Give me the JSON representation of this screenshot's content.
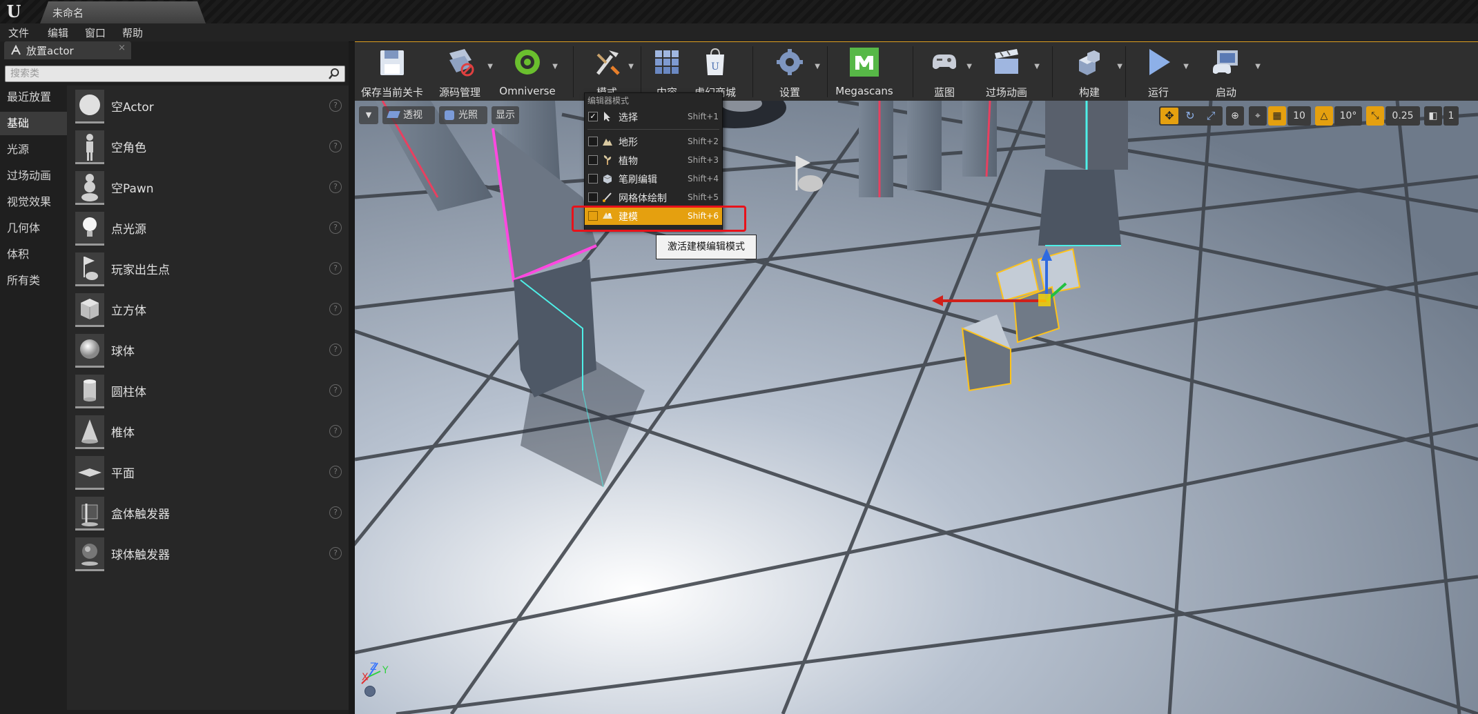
{
  "title_bar": {
    "document_tab": "未命名"
  },
  "menu_bar": {
    "items": [
      "文件",
      "编辑",
      "窗口",
      "帮助"
    ]
  },
  "place_panel": {
    "tab_label": "放置actor",
    "search_placeholder": "搜索类",
    "categories": [
      {
        "label": "最近放置",
        "active": false
      },
      {
        "label": "基础",
        "active": true
      },
      {
        "label": "光源",
        "active": false
      },
      {
        "label": "过场动画",
        "active": false
      },
      {
        "label": "视觉效果",
        "active": false
      },
      {
        "label": "几何体",
        "active": false
      },
      {
        "label": "体积",
        "active": false
      },
      {
        "label": "所有类",
        "active": false
      }
    ],
    "items": [
      {
        "label": "空Actor",
        "icon": "sphere-white-icon"
      },
      {
        "label": "空角色",
        "icon": "mannequin-icon"
      },
      {
        "label": "空Pawn",
        "icon": "pawn-icon"
      },
      {
        "label": "点光源",
        "icon": "lightbulb-icon"
      },
      {
        "label": "玩家出生点",
        "icon": "player-start-icon"
      },
      {
        "label": "立方体",
        "icon": "cube-icon"
      },
      {
        "label": "球体",
        "icon": "sphere-icon"
      },
      {
        "label": "圆柱体",
        "icon": "cylinder-icon"
      },
      {
        "label": "椎体",
        "icon": "cone-icon"
      },
      {
        "label": "平面",
        "icon": "plane-icon"
      },
      {
        "label": "盒体触发器",
        "icon": "box-trigger-icon"
      },
      {
        "label": "球体触发器",
        "icon": "sphere-trigger-icon"
      }
    ],
    "help_glyph": "?"
  },
  "toolbar": {
    "buttons": [
      {
        "label": "保存当前关卡",
        "icon": "save-icon",
        "dropdown": false
      },
      {
        "label": "源码管理",
        "icon": "source-control-icon",
        "dropdown": true
      },
      {
        "label": "Omniverse",
        "icon": "omniverse-icon",
        "dropdown": true
      },
      {
        "label": "模式",
        "icon": "modes-icon",
        "dropdown": true
      },
      {
        "label": "内容",
        "icon": "content-icon",
        "dropdown": false
      },
      {
        "label": "虚幻商城",
        "icon": "marketplace-icon",
        "dropdown": false
      },
      {
        "label": "设置",
        "icon": "settings-icon",
        "dropdown": true
      },
      {
        "label": "Megascans",
        "icon": "megascans-icon",
        "dropdown": false
      },
      {
        "label": "蓝图",
        "icon": "blueprint-icon",
        "dropdown": true
      },
      {
        "label": "过场动画",
        "icon": "cinematics-icon",
        "dropdown": true
      },
      {
        "label": "构建",
        "icon": "build-icon",
        "dropdown": true
      },
      {
        "label": "运行",
        "icon": "play-icon",
        "dropdown": true
      },
      {
        "label": "启动",
        "icon": "launch-icon",
        "dropdown": true
      }
    ]
  },
  "viewport": {
    "buttons": [
      {
        "label": "",
        "icon": "viewport-menu-icon"
      },
      {
        "label": "透视",
        "icon": "perspective-icon"
      },
      {
        "label": "光照",
        "icon": "lit-icon"
      },
      {
        "label": "显示",
        "icon": ""
      }
    ],
    "snap": {
      "grid_value": "10",
      "rotation_value": "10°",
      "scale_value": "0.25",
      "camera_speed": "1"
    },
    "axis_labels": {
      "x": "X",
      "y": "Y",
      "z": "Z"
    }
  },
  "modes_menu": {
    "header": "编辑器模式",
    "items": [
      {
        "label": "选择",
        "shortcut": "Shift+1",
        "checked": true,
        "highlighted": false,
        "icon": "select-arrow-icon"
      },
      {
        "label": "地形",
        "shortcut": "Shift+2",
        "checked": false,
        "highlighted": false,
        "icon": "landscape-icon"
      },
      {
        "label": "植物",
        "shortcut": "Shift+3",
        "checked": false,
        "highlighted": false,
        "icon": "foliage-icon"
      },
      {
        "label": "笔刷编辑",
        "shortcut": "Shift+4",
        "checked": false,
        "highlighted": false,
        "icon": "brush-edit-icon"
      },
      {
        "label": "网格体绘制",
        "shortcut": "Shift+5",
        "checked": false,
        "highlighted": false,
        "icon": "mesh-paint-icon"
      },
      {
        "label": "建模",
        "shortcut": "Shift+6",
        "checked": false,
        "highlighted": true,
        "icon": "modeling-icon"
      }
    ],
    "tooltip": "激活建模编辑模式"
  },
  "colors": {
    "accent": "#e5a00f",
    "highlight_box": "#e8121a",
    "megascans": "#57b847"
  }
}
